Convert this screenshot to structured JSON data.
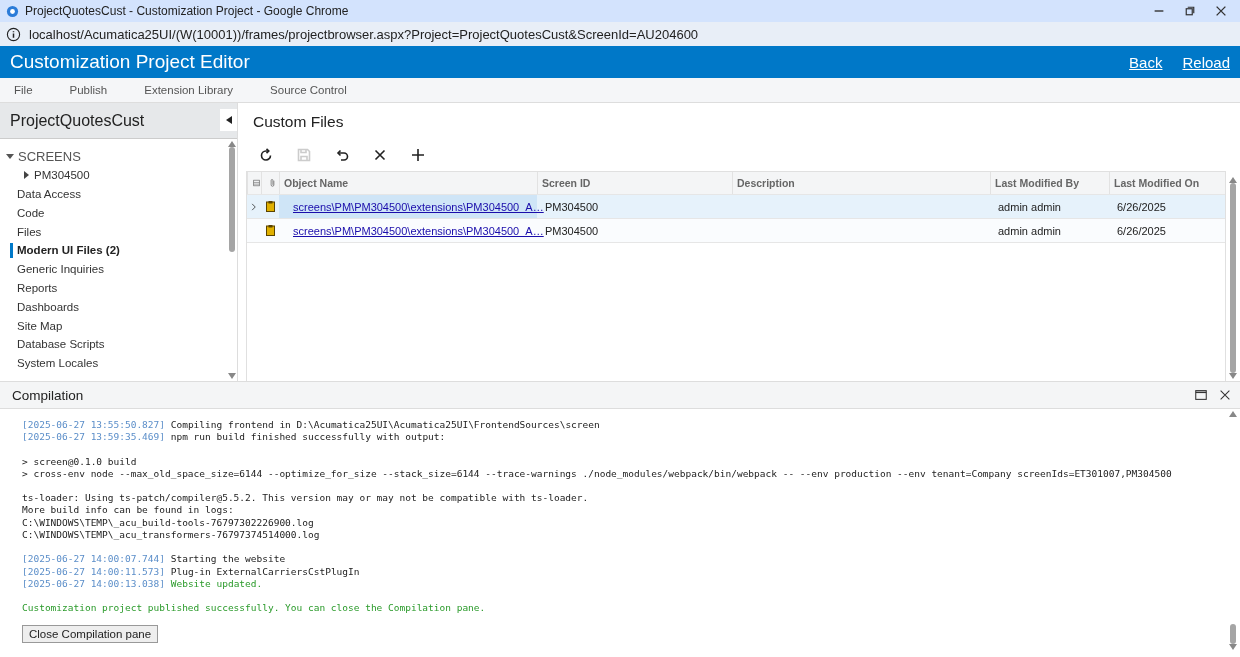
{
  "window": {
    "title": "ProjectQuotesCust - Customization Project - Google Chrome"
  },
  "address_bar": {
    "url": "localhost/Acumatica25UI/(W(10001))/frames/projectbrowser.aspx?Project=ProjectQuotesCust&ScreenId=AU204600"
  },
  "header": {
    "title": "Customization Project Editor",
    "links": [
      "Back",
      "Reload"
    ]
  },
  "menu": [
    "File",
    "Publish",
    "Extension Library",
    "Source Control"
  ],
  "sidebar": {
    "title": "ProjectQuotesCust",
    "items": [
      {
        "label": "SCREENS",
        "selected": false,
        "expanded": true,
        "children": [
          {
            "label": "PM304500",
            "selected": false,
            "expanded": false
          }
        ]
      },
      {
        "label": "Data Access",
        "selected": false
      },
      {
        "label": "Code",
        "selected": false
      },
      {
        "label": "Files",
        "selected": false
      },
      {
        "label": "Modern UI Files (2)",
        "selected": true
      },
      {
        "label": "Generic Inquiries",
        "selected": false
      },
      {
        "label": "Reports",
        "selected": false
      },
      {
        "label": "Dashboards",
        "selected": false
      },
      {
        "label": "Site Map",
        "selected": false
      },
      {
        "label": "Database Scripts",
        "selected": false
      },
      {
        "label": "System Locales",
        "selected": false
      }
    ]
  },
  "content": {
    "title": "Custom Files",
    "toolbar": [
      {
        "kind": "refresh",
        "disabled": false
      },
      {
        "kind": "save",
        "disabled": true
      },
      {
        "kind": "undo",
        "disabled": false
      },
      {
        "kind": "delete",
        "disabled": false
      },
      {
        "kind": "add",
        "disabled": false
      }
    ],
    "table": {
      "columns": [
        "Object Name",
        "Screen ID",
        "Description",
        "Last Modified By",
        "Last Modified On"
      ],
      "rows": [
        {
          "selected": true,
          "cells": [
            "screens\\PM\\PM304500\\extensions\\PM304500_A…",
            "PM304500",
            "",
            "admin admin",
            "6/26/2025"
          ]
        },
        {
          "selected": false,
          "cells": [
            "screens\\PM\\PM304500\\extensions\\PM304500_A…",
            "PM304500",
            "",
            "admin admin",
            "6/26/2025"
          ]
        }
      ]
    }
  },
  "compilation": {
    "title": "Compilation",
    "blocks": [
      [
        {
          "time": "[2025-06-27 13:55:50.827]",
          "text": "Compiling frontend in D:\\Acumatica25UI\\Acumatica25UI\\FrontendSources\\screen",
          "success": false
        },
        {
          "time": "[2025-06-27 13:59:35.469]",
          "text": "npm run build finished successfully with output:",
          "success": false
        }
      ],
      [
        {
          "text": "> screen@0.1.0 build",
          "success": false
        },
        {
          "text": "> cross-env node --max_old_space_size=6144 --optimize_for_size --stack_size=6144 --trace-warnings ./node_modules/webpack/bin/webpack -- --env production --env tenant=Company screenIds=ET301007,PM304500",
          "success": false
        }
      ],
      [
        {
          "text": "ts-loader: Using ts-patch/compiler@5.5.2. This version may or may not be compatible with ts-loader.",
          "success": false
        },
        {
          "text": "More build info can be found in logs:",
          "success": false
        },
        {
          "text": "C:\\WINDOWS\\TEMP\\_acu_build-tools-76797302226900.log",
          "success": false
        },
        {
          "text": "C:\\WINDOWS\\TEMP\\_acu_transformers-76797374514000.log",
          "success": false
        }
      ],
      [
        {
          "time": "[2025-06-27 14:00:07.744]",
          "text": "Starting the website",
          "success": false
        },
        {
          "time": "[2025-06-27 14:00:11.573]",
          "text": "Plug-in ExternalCarriersCstPlugIn",
          "success": false
        },
        {
          "time": "[2025-06-27 14:00:13.038]",
          "text": "Website updated.",
          "success": true
        }
      ],
      [
        {
          "text": "Customization project published successfully. You can close the Compilation pane.",
          "success": true
        }
      ]
    ],
    "button": "Close Compilation pane"
  }
}
